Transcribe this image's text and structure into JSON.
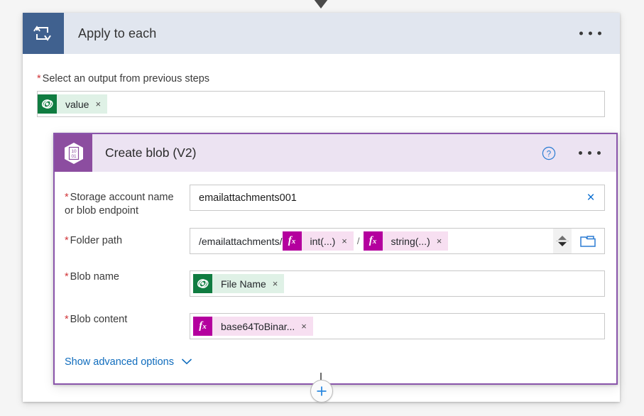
{
  "canvas": {
    "connector_arrow_icon": "down-arrow-icon",
    "add_step_icon": "plus-icon"
  },
  "apply_to_each": {
    "icon": "loop-repeat-icon",
    "title": "Apply to each",
    "menu_icon": "ellipsis-icon",
    "output_field": {
      "required_marker": "*",
      "label": "Select an output from previous steps",
      "token": {
        "icon": "office365-outlook-icon",
        "text": "value",
        "remove_icon": "close-icon",
        "remove_glyph": "×"
      }
    }
  },
  "create_blob": {
    "icon": "azure-blob-storage-icon",
    "icon_digits_top": "10",
    "icon_digits_bottom": "01",
    "title": "Create blob (V2)",
    "help_icon": "help-circle-icon",
    "help_glyph": "?",
    "menu_icon": "ellipsis-icon",
    "fields": {
      "storage_account": {
        "required_marker": "*",
        "label_line1": "Storage account name",
        "label_line2": "or blob endpoint",
        "value": "emailattachments001",
        "placeholder": "",
        "clear_icon": "close-icon",
        "clear_glyph": "×"
      },
      "folder_path": {
        "required_marker": "*",
        "label": "Folder path",
        "prefix_text": "/emailattachments/",
        "separator": "/",
        "tokens": [
          {
            "icon": "function-icon",
            "fx_label": "fx",
            "text": "int(...)",
            "remove_glyph": "×"
          },
          {
            "icon": "function-icon",
            "fx_label": "fx",
            "text": "string(...)",
            "remove_glyph": "×"
          }
        ],
        "spinner_icon": "stepper-updown-icon",
        "picker_icon": "folder-icon"
      },
      "blob_name": {
        "required_marker": "*",
        "label": "Blob name",
        "token": {
          "icon": "office365-outlook-icon",
          "text": "File Name",
          "remove_glyph": "×"
        }
      },
      "blob_content": {
        "required_marker": "*",
        "label": "Blob content",
        "token": {
          "icon": "function-icon",
          "fx_label": "fx",
          "text": "base64ToBinar...",
          "remove_glyph": "×"
        }
      }
    },
    "advanced_options": {
      "label": "Show advanced options",
      "chevron_icon": "chevron-down-icon"
    }
  },
  "colors": {
    "apply_header_bg": "#e1e6ef",
    "apply_icon_bg": "#40618f",
    "blob_card_border": "#8a55ab",
    "blob_header_bg": "#ece3f2",
    "blob_icon_bg": "#8c4da0",
    "token_green": "#107c41",
    "token_green_bg": "#dff1e6",
    "token_fx_magenta": "#b4009e",
    "token_fx_bg": "#f7dff1",
    "link_blue": "#0f6cbd",
    "required_red": "#d13438",
    "page_bg": "#f5f5f5"
  }
}
